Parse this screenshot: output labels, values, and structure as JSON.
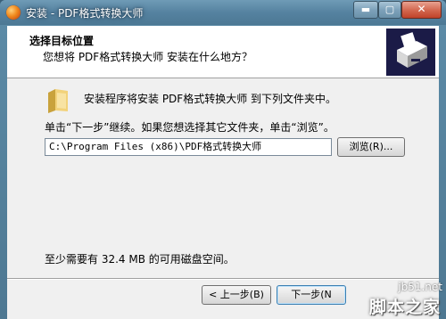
{
  "window": {
    "title": "安装 - PDF格式转换大师",
    "minimize_glyph": "▬",
    "maximize_glyph": "▢",
    "close_glyph": "✕"
  },
  "header": {
    "title": "选择目标位置",
    "subtitle": "您想将 PDF格式转换大师 安装在什么地方？"
  },
  "body": {
    "install_text": "安装程序将安装 PDF格式转换大师 到下列文件夹中。",
    "click_text": "单击“下一步”继续。如果您想选择其它文件夹，单击“浏览”。",
    "path_value": "C:\\Program Files (x86)\\PDF格式转换大师",
    "browse_label": "浏览(R)...",
    "space_text": "至少需要有 32.4 MB 的可用磁盘空间。"
  },
  "footer": {
    "prev_label": "< 上一步(B)",
    "next_label": "下一步(N"
  },
  "watermark": {
    "site": "jb51.net",
    "text": "脚本之家"
  },
  "colors": {
    "logo_bg": "#1b1b47",
    "folder": "#e8c35a",
    "close_button": "#c0432a"
  }
}
